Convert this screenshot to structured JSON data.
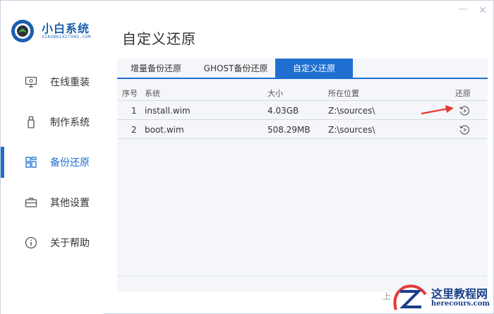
{
  "app": {
    "title": "小白系统",
    "subtitle": "XIAOBAIXITONG.COM"
  },
  "window": {
    "minimize_glyph": "—",
    "close_glyph": "✕"
  },
  "sidebar": {
    "items": [
      {
        "label": "在线重装",
        "icon": "monitor-icon"
      },
      {
        "label": "制作系统",
        "icon": "usb-icon"
      },
      {
        "label": "备份还原",
        "icon": "backup-icon",
        "active": true
      },
      {
        "label": "其他设置",
        "icon": "briefcase-icon"
      },
      {
        "label": "关于帮助",
        "icon": "info-icon"
      }
    ]
  },
  "main": {
    "page_title": "自定义还原",
    "tabs": [
      {
        "label": "增量备份还原"
      },
      {
        "label": "GHOST备份还原"
      },
      {
        "label": "自定义还原",
        "active": true
      }
    ],
    "table": {
      "headers": {
        "num": "序号",
        "system": "系统",
        "size": "大小",
        "location": "所在位置",
        "action": "还原"
      },
      "rows": [
        {
          "num": "1",
          "system": "install.wim",
          "size": "4.03GB",
          "location": "Z:\\sources\\"
        },
        {
          "num": "2",
          "system": "boot.wim",
          "size": "508.29MB",
          "location": "Z:\\sources\\"
        }
      ]
    },
    "bottom_label": "上"
  },
  "watermark": {
    "title": "这里教程网",
    "url": "herecours.com"
  },
  "colors": {
    "accent": "#1f6fd1",
    "arrow": "#e53935",
    "panel_bg": "#f4f6f9"
  }
}
